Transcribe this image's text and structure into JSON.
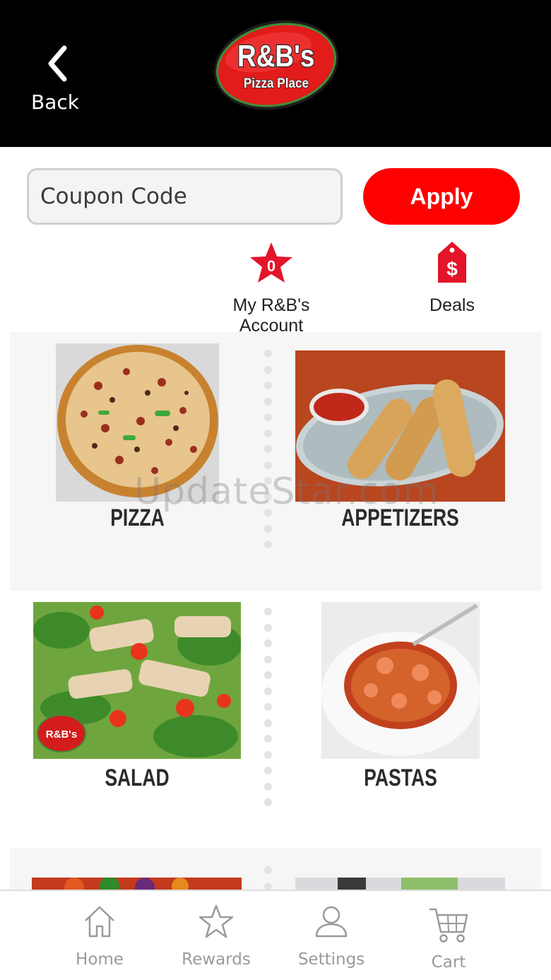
{
  "header": {
    "back_label": "Back",
    "logo": {
      "line1": "R&B's",
      "line2": "Pizza Place"
    }
  },
  "coupon": {
    "placeholder": "Coupon Code",
    "apply_label": "Apply"
  },
  "quick_links": {
    "account": {
      "label": "My R&B's Account",
      "badge": "0"
    },
    "deals": {
      "label": "Deals",
      "icon_symbol": "$"
    }
  },
  "menu": {
    "categories": [
      {
        "label": "PIZZA",
        "icon": "pizza-image"
      },
      {
        "label": "APPETIZERS",
        "icon": "appetizers-image"
      },
      {
        "label": "SALAD",
        "icon": "salad-image",
        "logo_badge": "R&B's"
      },
      {
        "label": "PASTAS",
        "icon": "pastas-image"
      }
    ]
  },
  "watermark": "UpdateStar.com",
  "bottom_nav": {
    "items": [
      {
        "label": "Home",
        "icon": "home-icon"
      },
      {
        "label": "Rewards",
        "icon": "star-icon"
      },
      {
        "label": "Settings",
        "icon": "user-icon"
      },
      {
        "label": "Cart",
        "icon": "cart-icon"
      }
    ]
  },
  "colors": {
    "accent": "#ff0000",
    "header_bg": "#000000",
    "band_bg": "#f6f6f6",
    "nav_text": "#9a9a9a"
  }
}
